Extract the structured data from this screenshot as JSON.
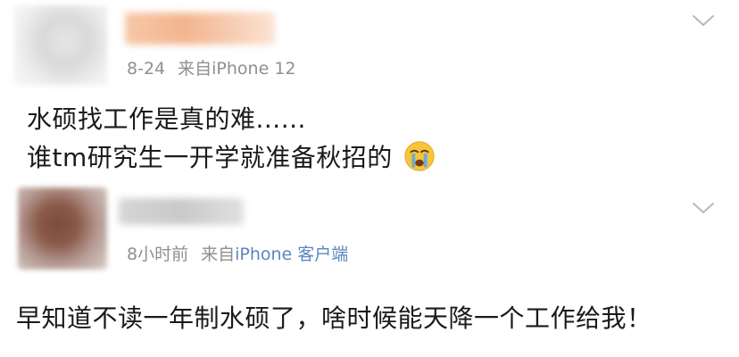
{
  "comments": [
    {
      "date": "8-24",
      "source_prefix": "来自",
      "source_device": "iPhone 12",
      "text_line_1": "水硕找工作是真的难......",
      "text_line_2": "谁tm研究生一开学就准备秋招的",
      "emoji": "crying-face-emoji"
    },
    {
      "date": "8小时前",
      "source_prefix": "来自",
      "source_device": "iPhone 客户端",
      "text": "早知道不读一年制水硕了，啥时候能天降一个工作给我！"
    }
  ],
  "icons": {
    "more": "chevron-down-icon"
  },
  "colors": {
    "meta_gray": "#8f8f8f",
    "link_blue": "#5a86c0",
    "text_dark": "#1a1a1a"
  }
}
